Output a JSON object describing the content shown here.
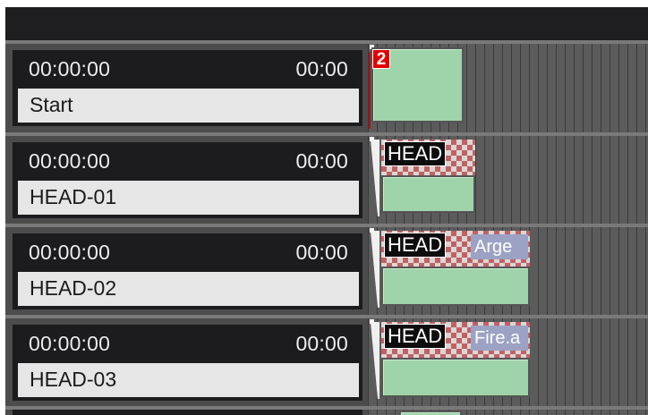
{
  "tracks": [
    {
      "start_time": "00:00:00",
      "duration": "00:00",
      "name": "Start",
      "clip_label": "",
      "clip_file": "",
      "marker": "2"
    },
    {
      "start_time": "00:00:00",
      "duration": "00:00",
      "name": "HEAD-01",
      "clip_label": "HEAD",
      "clip_file": ""
    },
    {
      "start_time": "00:00:00",
      "duration": "00:00",
      "name": "HEAD-02",
      "clip_label": "HEAD",
      "clip_file": "Arge"
    },
    {
      "start_time": "00:00:00",
      "duration": "00:00",
      "name": "HEAD-03",
      "clip_label": "HEAD",
      "clip_file": "Fire.a"
    }
  ],
  "colors": {
    "clip_green": "#9fd3aa",
    "marker_red": "#e00000",
    "header_dark": "#1c1c1f",
    "file_chip": "#9ca2c4"
  }
}
